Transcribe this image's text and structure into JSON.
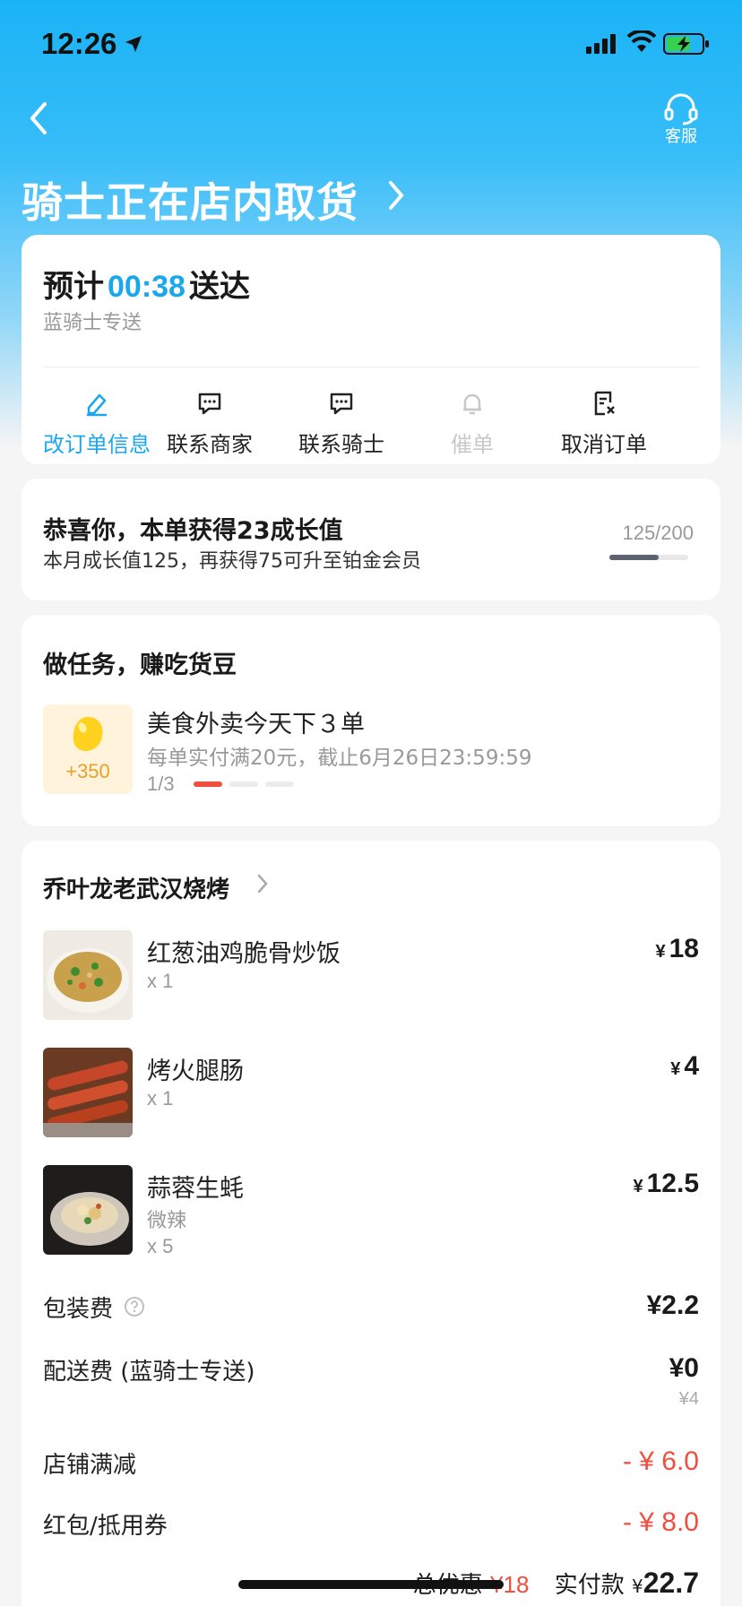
{
  "status_bar": {
    "time": "12:26"
  },
  "header": {
    "service_label": "客服",
    "title": "骑士正在店内取货"
  },
  "eta_card": {
    "prefix": "预计",
    "time": "00:38",
    "suffix": "送达",
    "subtitle": "蓝骑士专送",
    "actions": [
      {
        "label": "改订单信息",
        "icon": "edit-icon",
        "state": "active"
      },
      {
        "label": "联系商家",
        "icon": "chat-icon",
        "state": "normal"
      },
      {
        "label": "联系骑士",
        "icon": "chat-icon",
        "state": "normal"
      },
      {
        "label": "催单",
        "icon": "bell-icon",
        "state": "disabled"
      },
      {
        "label": "取消订单",
        "icon": "cancel-order-icon",
        "state": "normal"
      }
    ]
  },
  "growth_card": {
    "title": "恭喜你，本单获得23成长值",
    "subtitle": "本月成长值125，再获得75可升至铂金会员",
    "count": "125/200",
    "progress_fraction": 0.625
  },
  "task_card": {
    "title": "做任务，赚吃货豆",
    "reward": "+350",
    "task_name": "美食外卖今天下３单",
    "task_desc": "每单实付满20元，截止6月26日23:59:59",
    "progress": "1/3",
    "segments_done": 1,
    "segments_total": 3
  },
  "order_card": {
    "shop_name": "乔叶龙老武汉烧烤",
    "currency": "¥",
    "items": [
      {
        "name": "红葱油鸡脆骨炒饭",
        "spec": "",
        "qty": "x 1",
        "price": "18"
      },
      {
        "name": "烤火腿肠",
        "spec": "",
        "qty": "x 1",
        "price": "4"
      },
      {
        "name": "蒜蓉生蚝",
        "spec": "微辣",
        "qty": "x 5",
        "price": "12.5"
      }
    ],
    "packaging": {
      "label": "包装费",
      "value": "¥2.2"
    },
    "delivery": {
      "label": "配送费 (蓝骑士专送)",
      "value": "¥0",
      "original": "¥4"
    },
    "shop_discount": {
      "label": "店铺满减",
      "value": "- ¥ 6.0"
    },
    "coupon": {
      "label": "红包/抵用券",
      "value": "- ¥ 8.0"
    },
    "summary": {
      "discount_label": "总优惠",
      "discount_value": "¥18",
      "pay_label": "实付款",
      "pay_currency": "¥",
      "pay_value": "22.7"
    }
  },
  "colors": {
    "accent": "#1aa7ec",
    "red": "#f04e3e",
    "header_gradient": "#1ab3f6"
  }
}
